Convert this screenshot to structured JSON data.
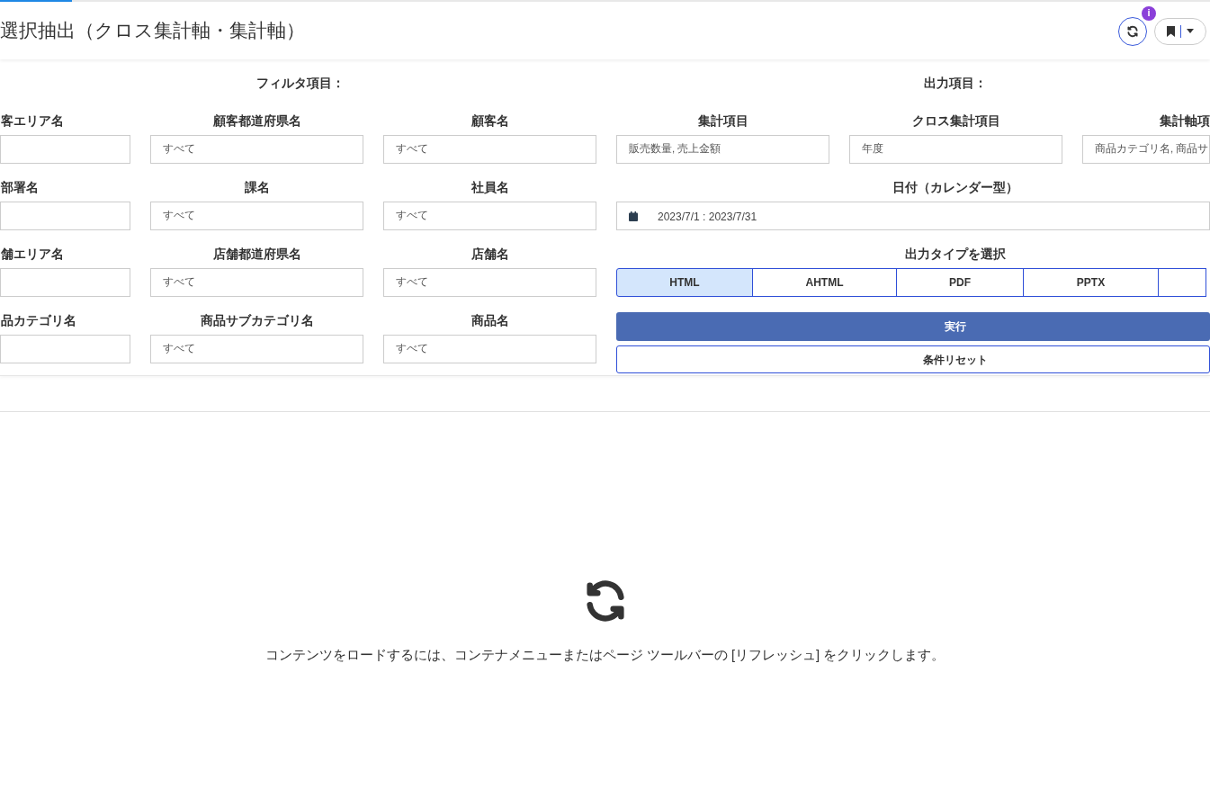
{
  "title": "選択抽出（クロス集計軸・集計軸）",
  "header_buttons": {
    "badge": "i"
  },
  "filter_heading": "フィルタ項目：",
  "filters": [
    {
      "label": "客エリア名"
    },
    {
      "label": "顧客都道府県名",
      "value": "すべて"
    },
    {
      "label": "顧客名",
      "value": "すべて"
    },
    {
      "label": "部署名"
    },
    {
      "label": "課名",
      "value": "すべて"
    },
    {
      "label": "社員名",
      "value": "すべて"
    },
    {
      "label": "舗エリア名"
    },
    {
      "label": "店舗都道府県名",
      "value": "すべて"
    },
    {
      "label": "店舗名",
      "value": "すべて"
    },
    {
      "label": "品カテゴリ名"
    },
    {
      "label": "商品サブカテゴリ名",
      "value": "すべて"
    },
    {
      "label": "商品名",
      "value": "すべて"
    }
  ],
  "output_heading": "出力項目：",
  "output_fields": [
    {
      "label": "集計項目",
      "value": "販売数量, 売上金額"
    },
    {
      "label": "クロス集計項目",
      "value": "年度"
    },
    {
      "label": "集計軸項",
      "value": "商品カテゴリ名, 商品サ"
    }
  ],
  "date": {
    "label": "日付（カレンダー型）",
    "value": "2023/7/1 : 2023/7/31"
  },
  "output_type": {
    "label": "出力タイプを選択",
    "options": [
      {
        "label": "HTML",
        "selected": true
      },
      {
        "label": "AHTML",
        "selected": false
      },
      {
        "label": "PDF",
        "selected": false
      },
      {
        "label": "PPTX",
        "selected": false
      },
      {
        "selected": false
      }
    ]
  },
  "run_button": "実行",
  "reset_button": "条件リセット",
  "message": "コンテンツをロードするには、コンテナメニューまたはページ ツールバーの [リフレッシュ] をクリックします。"
}
